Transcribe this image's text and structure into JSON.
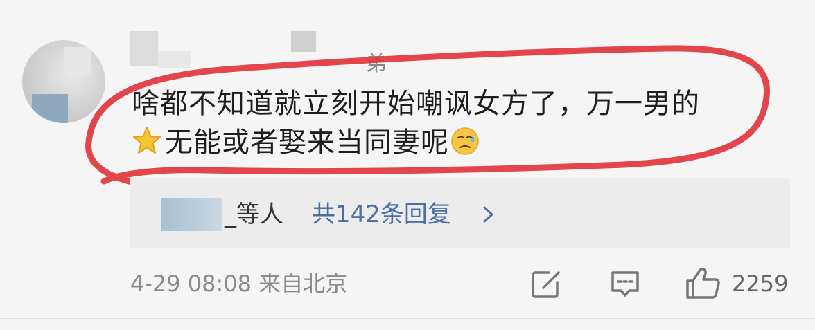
{
  "comment": {
    "line1": "啥都不知道就立刻开始嘲讽女方了，万一男的",
    "line2": "无能或者娶来当同妻呢"
  },
  "username_tail": "弟",
  "reply": {
    "suffix": "_等人",
    "link": "共142条回复"
  },
  "meta": {
    "date": "4-29 08:08",
    "location": "来自北京"
  },
  "likes": "2259",
  "colors": {
    "highlight_stroke": "#e0353c",
    "link": "#4a6ea8",
    "background": "#f5f5f5"
  },
  "icons": [
    "star-icon",
    "sweat-emoji-icon",
    "chevron-right-icon",
    "share-icon",
    "comment-icon",
    "like-icon"
  ]
}
